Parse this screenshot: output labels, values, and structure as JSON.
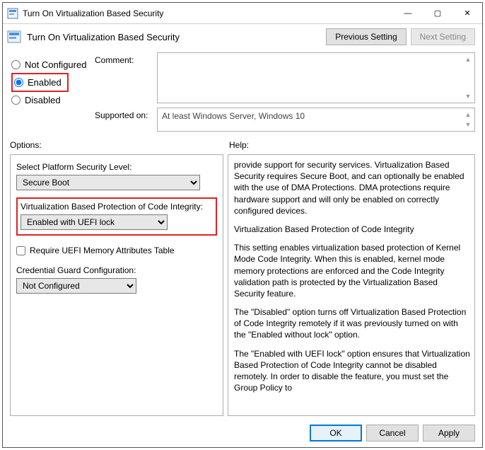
{
  "window": {
    "title": "Turn On Virtualization Based Security"
  },
  "subtitle": "Turn On Virtualization Based Security",
  "buttons": {
    "prev": "Previous Setting",
    "next": "Next Setting",
    "ok": "OK",
    "cancel": "Cancel",
    "apply": "Apply"
  },
  "radios": {
    "not_configured": "Not Configured",
    "enabled": "Enabled",
    "disabled": "Disabled"
  },
  "labels": {
    "comment": "Comment:",
    "supported_on": "Supported on:",
    "options": "Options:",
    "help": "Help:"
  },
  "supported_on": "At least Windows Server, Windows 10",
  "options": {
    "platform_label": "Select Platform Security Level:",
    "platform_value": "Secure Boot",
    "vbpci_label": "Virtualization Based Protection of Code Integrity:",
    "vbpci_value": "Enabled with UEFI lock",
    "require_uefi_mat": "Require UEFI Memory Attributes Table",
    "credguard_label": "Credential Guard Configuration:",
    "credguard_value": "Not Configured"
  },
  "help": {
    "p1": "provide support for security services. Virtualization Based Security requires Secure Boot, and can optionally be enabled with the use of DMA Protections. DMA protections require hardware support and will only be enabled on correctly configured devices.",
    "h1": "Virtualization Based Protection of Code Integrity",
    "p2": "This setting enables virtualization based protection of Kernel Mode Code Integrity. When this is enabled, kernel mode memory protections are enforced and the Code Integrity validation path is protected by the Virtualization Based Security feature.",
    "p3": "The \"Disabled\" option turns off Virtualization Based Protection of Code Integrity remotely if it was previously turned on with the \"Enabled without lock\" option.",
    "p4": "The \"Enabled with UEFI lock\" option ensures that Virtualization Based Protection of Code Integrity cannot be disabled remotely. In order to disable the feature, you must set the Group Policy to"
  }
}
